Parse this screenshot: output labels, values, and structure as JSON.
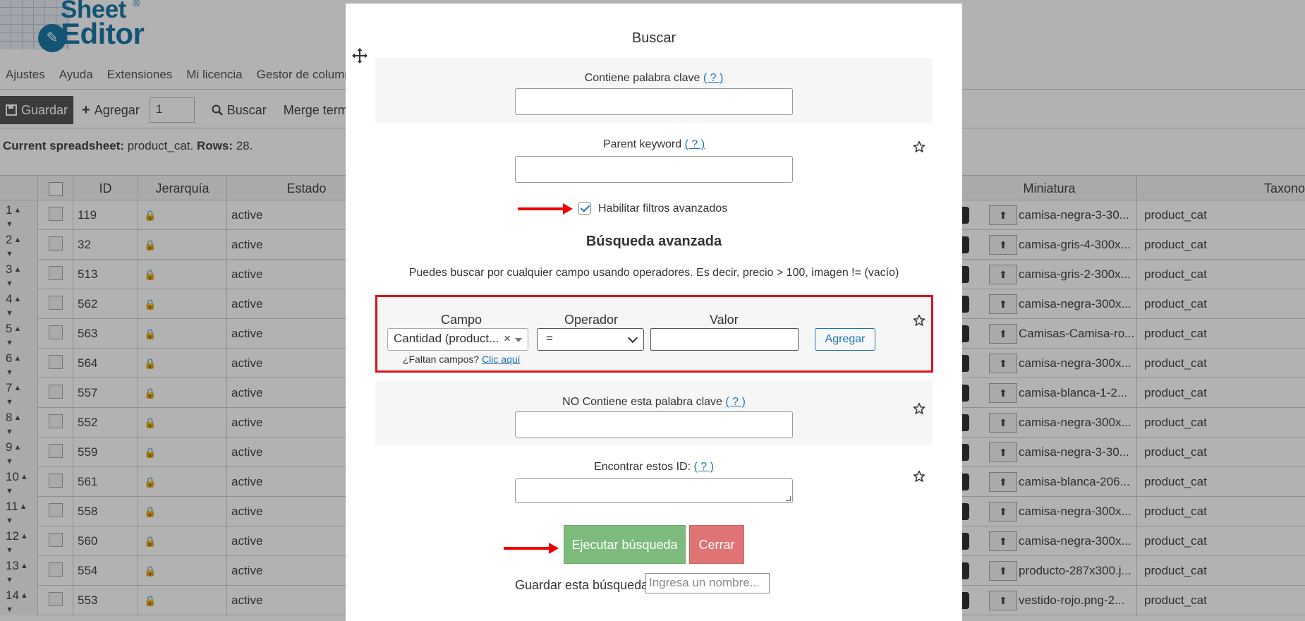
{
  "app": {
    "logo": {
      "line1": "Sheet",
      "line2": "Editor",
      "mark": "®"
    },
    "menu": [
      "Ajustes",
      "Ayuda",
      "Extensiones",
      "Mi licencia",
      "Gestor de columnas"
    ],
    "toolbar": {
      "save_label": "Guardar",
      "add_label": "Agregar",
      "add_count": "1",
      "search_label": "Buscar",
      "merge_label": "Merge term"
    },
    "current": {
      "label": "Current spreadsheet",
      "value": "product_cat.",
      "rows_label": "Rows:",
      "rows_value": "28."
    },
    "columns": {
      "id": "ID",
      "hierarchy": "Jerarquía",
      "state": "Estado",
      "thumbnail": "Miniatura",
      "taxonomy": "Taxono"
    },
    "rows": [
      {
        "n": "1",
        "id": "119",
        "state": "active",
        "mini": "camisa-negra-3-30...",
        "tax": "product_cat"
      },
      {
        "n": "2",
        "id": "32",
        "state": "active",
        "mini": "camisa-gris-4-300x...",
        "tax": "product_cat"
      },
      {
        "n": "3",
        "id": "513",
        "state": "active",
        "mini": "camisa-gris-2-300x...",
        "tax": "product_cat"
      },
      {
        "n": "4",
        "id": "562",
        "state": "active",
        "mini": "camisa-negra-300x...",
        "tax": "product_cat"
      },
      {
        "n": "5",
        "id": "563",
        "state": "active",
        "mini": "Camisas-Camisa-ro...",
        "tax": "product_cat"
      },
      {
        "n": "6",
        "id": "564",
        "state": "active",
        "mini": "camisa-negra-300x...",
        "tax": "product_cat"
      },
      {
        "n": "7",
        "id": "557",
        "state": "active",
        "mini": "camisa-blanca-1-2...",
        "tax": "product_cat"
      },
      {
        "n": "8",
        "id": "552",
        "state": "active",
        "mini": "camisa-negra-300x...",
        "tax": "product_cat"
      },
      {
        "n": "9",
        "id": "559",
        "state": "active",
        "mini": "camisa-negra-3-30...",
        "tax": "product_cat"
      },
      {
        "n": "10",
        "id": "561",
        "state": "active",
        "mini": "camisa-blanca-206...",
        "tax": "product_cat"
      },
      {
        "n": "11",
        "id": "558",
        "state": "active",
        "mini": "camisa-negra-300x...",
        "tax": "product_cat"
      },
      {
        "n": "12",
        "id": "560",
        "state": "active",
        "mini": "camisa-negra-300x...",
        "tax": "product_cat"
      },
      {
        "n": "13",
        "id": "554",
        "state": "active",
        "mini": "producto-287x300.j...",
        "tax": "product_cat"
      },
      {
        "n": "14",
        "id": "553",
        "state": "active",
        "mini": "vestido-rojo.png-2...",
        "tax": "product_cat"
      }
    ]
  },
  "modal": {
    "title": "Buscar",
    "keyword": {
      "label": "Contiene palabra clave",
      "help": "( ? )"
    },
    "parent": {
      "label": "Parent keyword",
      "help": "( ? )"
    },
    "advanced_toggle": {
      "label": "Habilitar filtros avanzados",
      "checked": true
    },
    "advanced": {
      "title": "Búsqueda avanzada",
      "description": "Puedes buscar por cualquier campo usando operadores. Es decir, precio > 100, imagen != (vacío)",
      "field_label": "Campo",
      "operator_label": "Operador",
      "value_label": "Valor",
      "field_value": "Cantidad (product...",
      "operator_value": "=",
      "add_button": "Agregar",
      "missing_text": "¿Faltan campos?",
      "missing_link": "Clic aquí"
    },
    "not_keyword": {
      "label": "NO Contiene esta palabra clave",
      "help": "( ? )"
    },
    "ids": {
      "label": "Encontrar estos ID:",
      "help": "( ? )"
    },
    "run_button": "Ejecutar búsqueda",
    "close_button": "Cerrar",
    "save_label": "Guardar esta búsqueda",
    "save_placeholder": "Ingresa un nombre..."
  },
  "colors": {
    "accent_link": "#2271b1",
    "run_button": "#7dbb7d",
    "close_button": "#e07373",
    "highlight_border": "#e0101a",
    "annotation_arrow": "#ee0000"
  },
  "icons": [
    "move-icon",
    "star-icon",
    "save-icon",
    "plus-icon",
    "search-icon",
    "lock-icon",
    "upload-icon",
    "sort-arrows-icon",
    "chevron-down-icon",
    "clear-icon"
  ]
}
